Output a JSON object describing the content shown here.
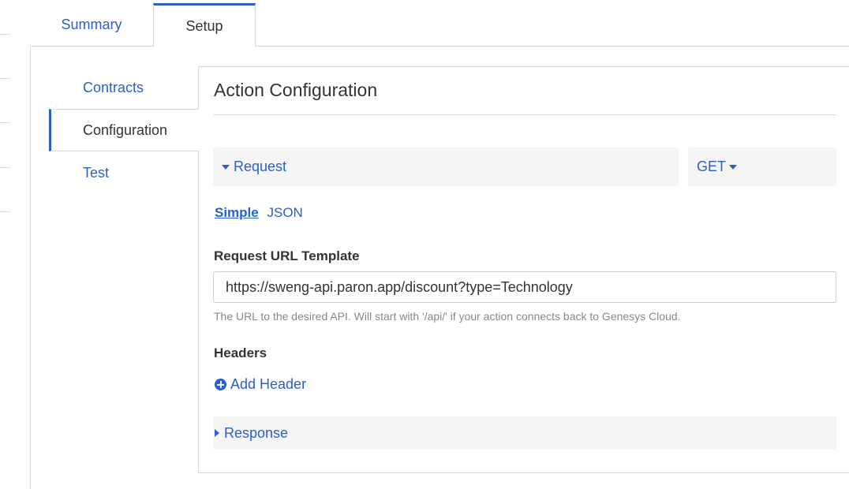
{
  "tabs": {
    "summary": "Summary",
    "setup": "Setup"
  },
  "sidenav": {
    "contracts": "Contracts",
    "configuration": "Configuration",
    "test": "Test"
  },
  "panel": {
    "title": "Action Configuration",
    "request_label": "Request",
    "method": "GET",
    "mode_simple": "Simple",
    "mode_json": "JSON",
    "url_label": "Request URL Template",
    "url_value": "https://sweng-api.paron.app/discount?type=Technology",
    "url_help": "The URL to the desired API. Will start with '/api/' if your action connects back to Genesys Cloud.",
    "headers_label": "Headers",
    "add_header": "Add Header",
    "response_label": "Response"
  },
  "icons": {
    "request_toggle": "caret-down-icon",
    "method_dropdown": "caret-down-icon",
    "add_header": "plus-circle-icon",
    "response_toggle": "caret-right-icon"
  },
  "colors": {
    "accent": "#2a60c8",
    "text": "#333333",
    "muted": "#888888",
    "section_bg": "#f5f5f5",
    "border": "#d9d9d9"
  }
}
